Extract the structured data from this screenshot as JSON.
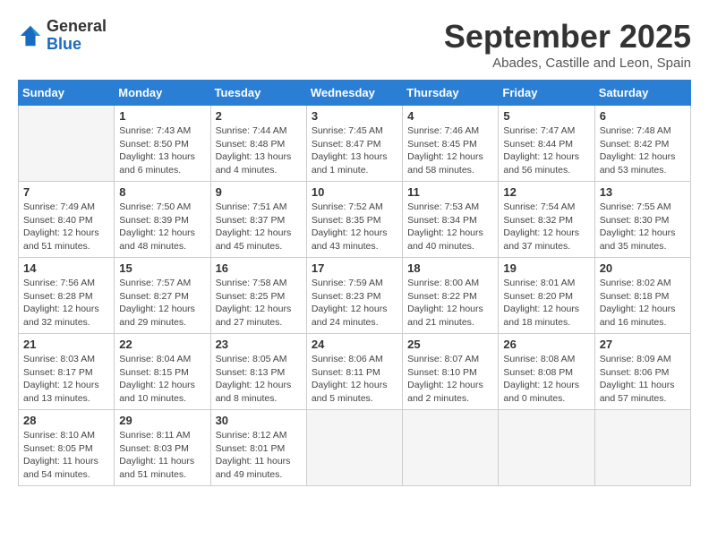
{
  "logo": {
    "general": "General",
    "blue": "Blue"
  },
  "title": "September 2025",
  "location": "Abades, Castille and Leon, Spain",
  "days_of_week": [
    "Sunday",
    "Monday",
    "Tuesday",
    "Wednesday",
    "Thursday",
    "Friday",
    "Saturday"
  ],
  "weeks": [
    [
      {
        "day": "",
        "sunrise": "",
        "sunset": "",
        "daylight": ""
      },
      {
        "day": "1",
        "sunrise": "Sunrise: 7:43 AM",
        "sunset": "Sunset: 8:50 PM",
        "daylight": "Daylight: 13 hours and 6 minutes."
      },
      {
        "day": "2",
        "sunrise": "Sunrise: 7:44 AM",
        "sunset": "Sunset: 8:48 PM",
        "daylight": "Daylight: 13 hours and 4 minutes."
      },
      {
        "day": "3",
        "sunrise": "Sunrise: 7:45 AM",
        "sunset": "Sunset: 8:47 PM",
        "daylight": "Daylight: 13 hours and 1 minute."
      },
      {
        "day": "4",
        "sunrise": "Sunrise: 7:46 AM",
        "sunset": "Sunset: 8:45 PM",
        "daylight": "Daylight: 12 hours and 58 minutes."
      },
      {
        "day": "5",
        "sunrise": "Sunrise: 7:47 AM",
        "sunset": "Sunset: 8:44 PM",
        "daylight": "Daylight: 12 hours and 56 minutes."
      },
      {
        "day": "6",
        "sunrise": "Sunrise: 7:48 AM",
        "sunset": "Sunset: 8:42 PM",
        "daylight": "Daylight: 12 hours and 53 minutes."
      }
    ],
    [
      {
        "day": "7",
        "sunrise": "Sunrise: 7:49 AM",
        "sunset": "Sunset: 8:40 PM",
        "daylight": "Daylight: 12 hours and 51 minutes."
      },
      {
        "day": "8",
        "sunrise": "Sunrise: 7:50 AM",
        "sunset": "Sunset: 8:39 PM",
        "daylight": "Daylight: 12 hours and 48 minutes."
      },
      {
        "day": "9",
        "sunrise": "Sunrise: 7:51 AM",
        "sunset": "Sunset: 8:37 PM",
        "daylight": "Daylight: 12 hours and 45 minutes."
      },
      {
        "day": "10",
        "sunrise": "Sunrise: 7:52 AM",
        "sunset": "Sunset: 8:35 PM",
        "daylight": "Daylight: 12 hours and 43 minutes."
      },
      {
        "day": "11",
        "sunrise": "Sunrise: 7:53 AM",
        "sunset": "Sunset: 8:34 PM",
        "daylight": "Daylight: 12 hours and 40 minutes."
      },
      {
        "day": "12",
        "sunrise": "Sunrise: 7:54 AM",
        "sunset": "Sunset: 8:32 PM",
        "daylight": "Daylight: 12 hours and 37 minutes."
      },
      {
        "day": "13",
        "sunrise": "Sunrise: 7:55 AM",
        "sunset": "Sunset: 8:30 PM",
        "daylight": "Daylight: 12 hours and 35 minutes."
      }
    ],
    [
      {
        "day": "14",
        "sunrise": "Sunrise: 7:56 AM",
        "sunset": "Sunset: 8:28 PM",
        "daylight": "Daylight: 12 hours and 32 minutes."
      },
      {
        "day": "15",
        "sunrise": "Sunrise: 7:57 AM",
        "sunset": "Sunset: 8:27 PM",
        "daylight": "Daylight: 12 hours and 29 minutes."
      },
      {
        "day": "16",
        "sunrise": "Sunrise: 7:58 AM",
        "sunset": "Sunset: 8:25 PM",
        "daylight": "Daylight: 12 hours and 27 minutes."
      },
      {
        "day": "17",
        "sunrise": "Sunrise: 7:59 AM",
        "sunset": "Sunset: 8:23 PM",
        "daylight": "Daylight: 12 hours and 24 minutes."
      },
      {
        "day": "18",
        "sunrise": "Sunrise: 8:00 AM",
        "sunset": "Sunset: 8:22 PM",
        "daylight": "Daylight: 12 hours and 21 minutes."
      },
      {
        "day": "19",
        "sunrise": "Sunrise: 8:01 AM",
        "sunset": "Sunset: 8:20 PM",
        "daylight": "Daylight: 12 hours and 18 minutes."
      },
      {
        "day": "20",
        "sunrise": "Sunrise: 8:02 AM",
        "sunset": "Sunset: 8:18 PM",
        "daylight": "Daylight: 12 hours and 16 minutes."
      }
    ],
    [
      {
        "day": "21",
        "sunrise": "Sunrise: 8:03 AM",
        "sunset": "Sunset: 8:17 PM",
        "daylight": "Daylight: 12 hours and 13 minutes."
      },
      {
        "day": "22",
        "sunrise": "Sunrise: 8:04 AM",
        "sunset": "Sunset: 8:15 PM",
        "daylight": "Daylight: 12 hours and 10 minutes."
      },
      {
        "day": "23",
        "sunrise": "Sunrise: 8:05 AM",
        "sunset": "Sunset: 8:13 PM",
        "daylight": "Daylight: 12 hours and 8 minutes."
      },
      {
        "day": "24",
        "sunrise": "Sunrise: 8:06 AM",
        "sunset": "Sunset: 8:11 PM",
        "daylight": "Daylight: 12 hours and 5 minutes."
      },
      {
        "day": "25",
        "sunrise": "Sunrise: 8:07 AM",
        "sunset": "Sunset: 8:10 PM",
        "daylight": "Daylight: 12 hours and 2 minutes."
      },
      {
        "day": "26",
        "sunrise": "Sunrise: 8:08 AM",
        "sunset": "Sunset: 8:08 PM",
        "daylight": "Daylight: 12 hours and 0 minutes."
      },
      {
        "day": "27",
        "sunrise": "Sunrise: 8:09 AM",
        "sunset": "Sunset: 8:06 PM",
        "daylight": "Daylight: 11 hours and 57 minutes."
      }
    ],
    [
      {
        "day": "28",
        "sunrise": "Sunrise: 8:10 AM",
        "sunset": "Sunset: 8:05 PM",
        "daylight": "Daylight: 11 hours and 54 minutes."
      },
      {
        "day": "29",
        "sunrise": "Sunrise: 8:11 AM",
        "sunset": "Sunset: 8:03 PM",
        "daylight": "Daylight: 11 hours and 51 minutes."
      },
      {
        "day": "30",
        "sunrise": "Sunrise: 8:12 AM",
        "sunset": "Sunset: 8:01 PM",
        "daylight": "Daylight: 11 hours and 49 minutes."
      },
      {
        "day": "",
        "sunrise": "",
        "sunset": "",
        "daylight": ""
      },
      {
        "day": "",
        "sunrise": "",
        "sunset": "",
        "daylight": ""
      },
      {
        "day": "",
        "sunrise": "",
        "sunset": "",
        "daylight": ""
      },
      {
        "day": "",
        "sunrise": "",
        "sunset": "",
        "daylight": ""
      }
    ]
  ]
}
